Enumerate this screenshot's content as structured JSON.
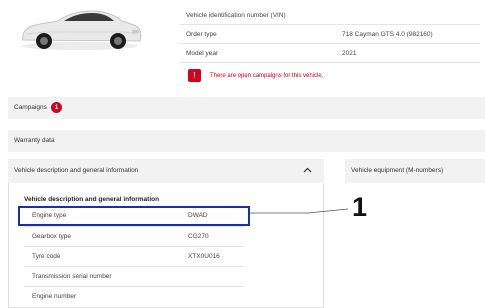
{
  "vehicle": {
    "rows": [
      {
        "label": "Vehicle identification number (VIN)",
        "value": ""
      },
      {
        "label": "Order type",
        "value": "718 Cayman GTS 4.0 (982160)"
      },
      {
        "label": "Model year",
        "value": "2021"
      }
    ],
    "alert": "There are open campaigns for this vehicle."
  },
  "sections": {
    "campaigns_label": "Campaigns",
    "campaigns_count": "1",
    "warranty_label": "Warranty data",
    "description_label": "Vehicle description and general information",
    "equipment_label": "Vehicle equipment (M-numbers)"
  },
  "panel": {
    "title": "Vehicle description and general information",
    "rows": [
      {
        "label": "Engine type",
        "value": "DWAD"
      },
      {
        "label": "Gearbox type",
        "value": "CG270"
      },
      {
        "label": "Tyre code",
        "value": "XTX0U016"
      },
      {
        "label": "Transmission serial number",
        "value": ""
      },
      {
        "label": "Engine number",
        "value": ""
      }
    ]
  },
  "callout": "1",
  "colors": {
    "accent_red": "#d5001c",
    "highlight_blue": "#1a2fb0",
    "bar_grey": "#f2f2f2"
  },
  "icons": {
    "alert": "exclamation-icon",
    "collapse": "chevron-up-icon",
    "car": "car-image"
  }
}
